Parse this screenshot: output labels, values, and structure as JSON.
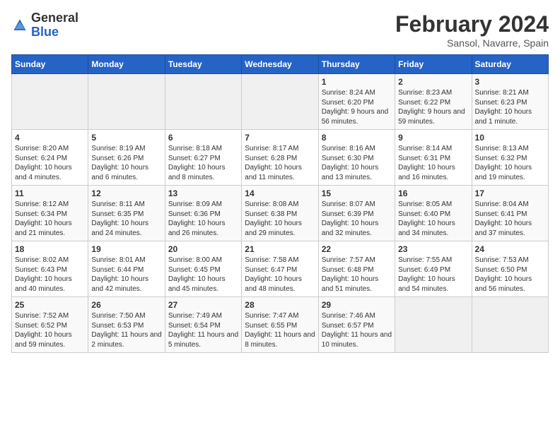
{
  "header": {
    "logo_general": "General",
    "logo_blue": "Blue",
    "title": "February 2024",
    "subtitle": "Sansol, Navarre, Spain"
  },
  "weekdays": [
    "Sunday",
    "Monday",
    "Tuesday",
    "Wednesday",
    "Thursday",
    "Friday",
    "Saturday"
  ],
  "weeks": [
    [
      {
        "day": "",
        "info": ""
      },
      {
        "day": "",
        "info": ""
      },
      {
        "day": "",
        "info": ""
      },
      {
        "day": "",
        "info": ""
      },
      {
        "day": "1",
        "info": "Sunrise: 8:24 AM\nSunset: 6:20 PM\nDaylight: 9 hours and 56 minutes."
      },
      {
        "day": "2",
        "info": "Sunrise: 8:23 AM\nSunset: 6:22 PM\nDaylight: 9 hours and 59 minutes."
      },
      {
        "day": "3",
        "info": "Sunrise: 8:21 AM\nSunset: 6:23 PM\nDaylight: 10 hours and 1 minute."
      }
    ],
    [
      {
        "day": "4",
        "info": "Sunrise: 8:20 AM\nSunset: 6:24 PM\nDaylight: 10 hours and 4 minutes."
      },
      {
        "day": "5",
        "info": "Sunrise: 8:19 AM\nSunset: 6:26 PM\nDaylight: 10 hours and 6 minutes."
      },
      {
        "day": "6",
        "info": "Sunrise: 8:18 AM\nSunset: 6:27 PM\nDaylight: 10 hours and 8 minutes."
      },
      {
        "day": "7",
        "info": "Sunrise: 8:17 AM\nSunset: 6:28 PM\nDaylight: 10 hours and 11 minutes."
      },
      {
        "day": "8",
        "info": "Sunrise: 8:16 AM\nSunset: 6:30 PM\nDaylight: 10 hours and 13 minutes."
      },
      {
        "day": "9",
        "info": "Sunrise: 8:14 AM\nSunset: 6:31 PM\nDaylight: 10 hours and 16 minutes."
      },
      {
        "day": "10",
        "info": "Sunrise: 8:13 AM\nSunset: 6:32 PM\nDaylight: 10 hours and 19 minutes."
      }
    ],
    [
      {
        "day": "11",
        "info": "Sunrise: 8:12 AM\nSunset: 6:34 PM\nDaylight: 10 hours and 21 minutes."
      },
      {
        "day": "12",
        "info": "Sunrise: 8:11 AM\nSunset: 6:35 PM\nDaylight: 10 hours and 24 minutes."
      },
      {
        "day": "13",
        "info": "Sunrise: 8:09 AM\nSunset: 6:36 PM\nDaylight: 10 hours and 26 minutes."
      },
      {
        "day": "14",
        "info": "Sunrise: 8:08 AM\nSunset: 6:38 PM\nDaylight: 10 hours and 29 minutes."
      },
      {
        "day": "15",
        "info": "Sunrise: 8:07 AM\nSunset: 6:39 PM\nDaylight: 10 hours and 32 minutes."
      },
      {
        "day": "16",
        "info": "Sunrise: 8:05 AM\nSunset: 6:40 PM\nDaylight: 10 hours and 34 minutes."
      },
      {
        "day": "17",
        "info": "Sunrise: 8:04 AM\nSunset: 6:41 PM\nDaylight: 10 hours and 37 minutes."
      }
    ],
    [
      {
        "day": "18",
        "info": "Sunrise: 8:02 AM\nSunset: 6:43 PM\nDaylight: 10 hours and 40 minutes."
      },
      {
        "day": "19",
        "info": "Sunrise: 8:01 AM\nSunset: 6:44 PM\nDaylight: 10 hours and 42 minutes."
      },
      {
        "day": "20",
        "info": "Sunrise: 8:00 AM\nSunset: 6:45 PM\nDaylight: 10 hours and 45 minutes."
      },
      {
        "day": "21",
        "info": "Sunrise: 7:58 AM\nSunset: 6:47 PM\nDaylight: 10 hours and 48 minutes."
      },
      {
        "day": "22",
        "info": "Sunrise: 7:57 AM\nSunset: 6:48 PM\nDaylight: 10 hours and 51 minutes."
      },
      {
        "day": "23",
        "info": "Sunrise: 7:55 AM\nSunset: 6:49 PM\nDaylight: 10 hours and 54 minutes."
      },
      {
        "day": "24",
        "info": "Sunrise: 7:53 AM\nSunset: 6:50 PM\nDaylight: 10 hours and 56 minutes."
      }
    ],
    [
      {
        "day": "25",
        "info": "Sunrise: 7:52 AM\nSunset: 6:52 PM\nDaylight: 10 hours and 59 minutes."
      },
      {
        "day": "26",
        "info": "Sunrise: 7:50 AM\nSunset: 6:53 PM\nDaylight: 11 hours and 2 minutes."
      },
      {
        "day": "27",
        "info": "Sunrise: 7:49 AM\nSunset: 6:54 PM\nDaylight: 11 hours and 5 minutes."
      },
      {
        "day": "28",
        "info": "Sunrise: 7:47 AM\nSunset: 6:55 PM\nDaylight: 11 hours and 8 minutes."
      },
      {
        "day": "29",
        "info": "Sunrise: 7:46 AM\nSunset: 6:57 PM\nDaylight: 11 hours and 10 minutes."
      },
      {
        "day": "",
        "info": ""
      },
      {
        "day": "",
        "info": ""
      }
    ]
  ]
}
